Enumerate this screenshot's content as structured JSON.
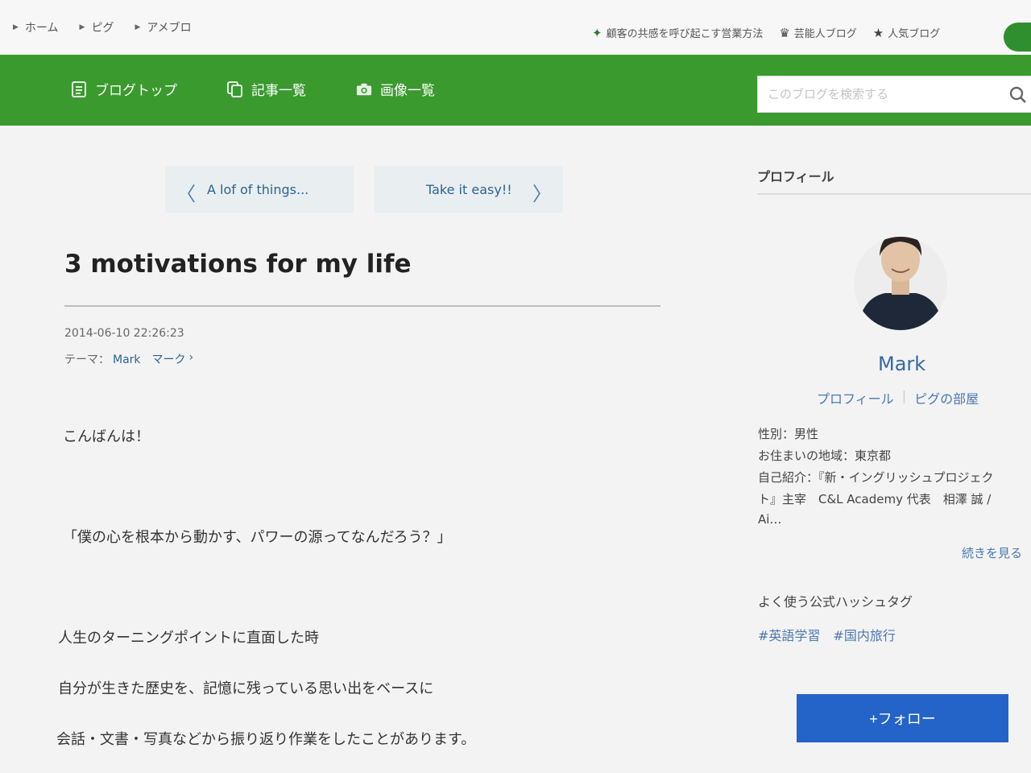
{
  "breadcrumb": [
    "ホーム",
    "ピグ",
    "アメブロ"
  ],
  "top_links": [
    {
      "icon": "sparkle-icon",
      "label": "顧客の共感を呼び起こす営業方法"
    },
    {
      "icon": "crown-icon",
      "label": "芸能人ブログ"
    },
    {
      "icon": "star-icon",
      "label": "人気ブログ"
    }
  ],
  "nav": {
    "items": [
      {
        "icon": "document-icon",
        "label": "ブログトップ"
      },
      {
        "icon": "copy-icon",
        "label": "記事一覧"
      },
      {
        "icon": "camera-icon",
        "label": "画像一覧"
      }
    ],
    "search_placeholder": "このブログを検索する",
    "search_icon": "search-icon"
  },
  "post": {
    "prev_label": "A lof of things...",
    "next_label": "Take it easy!!",
    "title": "3 motivations for my life",
    "date": "2014-06-10 22:26:23",
    "theme_prefix": "テーマ：",
    "theme": "Mark　マーク",
    "theme_chevron": "›",
    "body": [
      "こんばんは！",
      "「僕の心を根本から動かす、パワーの源ってなんだろう？」",
      "人生のターニングポイントに直面した時",
      "自分が生きた歴史を、記憶に残っている思い出をベースに",
      "会話・文書・写真などから振り返り作業をしたことがあります。"
    ]
  },
  "sidebar": {
    "heading": "プロフィール",
    "name": "Mark",
    "links": [
      "プロフィール",
      "ピグの部屋"
    ],
    "link_separator": "|",
    "info": [
      "性別：男性",
      "お住まいの地域：東京都",
      "自己紹介：『新・イングリッシュプロジェク",
      "ト』主宰　C&L Academy 代表　相澤 誠 /",
      "Ai…"
    ],
    "more_label": "続きを見る",
    "hashtag_heading": "よく使う公式ハッシュタグ",
    "hashtags": [
      "#英語学習",
      "#国内旅行"
    ],
    "follow_label": "+フォロー"
  },
  "colors": {
    "nav_green": "#3a9a2e",
    "link_blue": "#2a6496",
    "follow_blue": "#2463c8"
  }
}
